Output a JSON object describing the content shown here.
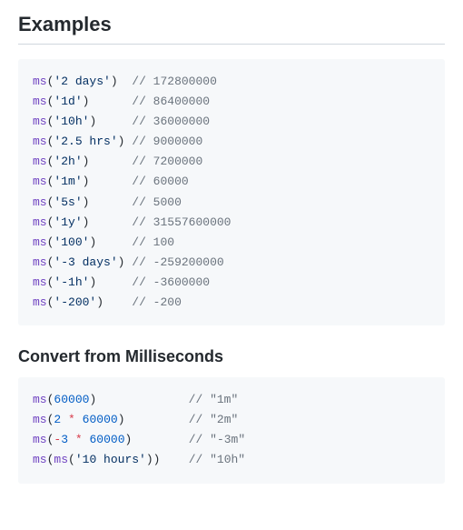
{
  "heading_examples": "Examples",
  "heading_convert": "Convert from Milliseconds",
  "block1": [
    {
      "call": "ms",
      "arg_type": "str",
      "arg": "'2 days'",
      "pad": "  ",
      "comment": "// 172800000"
    },
    {
      "call": "ms",
      "arg_type": "str",
      "arg": "'1d'",
      "pad": "      ",
      "comment": "// 86400000"
    },
    {
      "call": "ms",
      "arg_type": "str",
      "arg": "'10h'",
      "pad": "     ",
      "comment": "// 36000000"
    },
    {
      "call": "ms",
      "arg_type": "str",
      "arg": "'2.5 hrs'",
      "pad": " ",
      "comment": "// 9000000"
    },
    {
      "call": "ms",
      "arg_type": "str",
      "arg": "'2h'",
      "pad": "      ",
      "comment": "// 7200000"
    },
    {
      "call": "ms",
      "arg_type": "str",
      "arg": "'1m'",
      "pad": "      ",
      "comment": "// 60000"
    },
    {
      "call": "ms",
      "arg_type": "str",
      "arg": "'5s'",
      "pad": "      ",
      "comment": "// 5000"
    },
    {
      "call": "ms",
      "arg_type": "str",
      "arg": "'1y'",
      "pad": "      ",
      "comment": "// 31557600000"
    },
    {
      "call": "ms",
      "arg_type": "str",
      "arg": "'100'",
      "pad": "     ",
      "comment": "// 100"
    },
    {
      "call": "ms",
      "arg_type": "str",
      "arg": "'-3 days'",
      "pad": " ",
      "comment": "// -259200000"
    },
    {
      "call": "ms",
      "arg_type": "str",
      "arg": "'-1h'",
      "pad": "     ",
      "comment": "// -3600000"
    },
    {
      "call": "ms",
      "arg_type": "str",
      "arg": "'-200'",
      "pad": "    ",
      "comment": "// -200"
    }
  ],
  "block2": [
    {
      "tokens": [
        {
          "t": "fn",
          "v": "ms"
        },
        {
          "t": "plain",
          "v": "("
        },
        {
          "t": "num",
          "v": "60000"
        },
        {
          "t": "plain",
          "v": ")"
        }
      ],
      "pad": "             ",
      "comment": "// \"1m\""
    },
    {
      "tokens": [
        {
          "t": "fn",
          "v": "ms"
        },
        {
          "t": "plain",
          "v": "("
        },
        {
          "t": "num",
          "v": "2"
        },
        {
          "t": "plain",
          "v": " "
        },
        {
          "t": "op",
          "v": "*"
        },
        {
          "t": "plain",
          "v": " "
        },
        {
          "t": "num",
          "v": "60000"
        },
        {
          "t": "plain",
          "v": ")"
        }
      ],
      "pad": "         ",
      "comment": "// \"2m\""
    },
    {
      "tokens": [
        {
          "t": "fn",
          "v": "ms"
        },
        {
          "t": "plain",
          "v": "("
        },
        {
          "t": "op",
          "v": "-"
        },
        {
          "t": "num",
          "v": "3"
        },
        {
          "t": "plain",
          "v": " "
        },
        {
          "t": "op",
          "v": "*"
        },
        {
          "t": "plain",
          "v": " "
        },
        {
          "t": "num",
          "v": "60000"
        },
        {
          "t": "plain",
          "v": ")"
        }
      ],
      "pad": "        ",
      "comment": "// \"-3m\""
    },
    {
      "tokens": [
        {
          "t": "fn",
          "v": "ms"
        },
        {
          "t": "plain",
          "v": "("
        },
        {
          "t": "fn",
          "v": "ms"
        },
        {
          "t": "plain",
          "v": "("
        },
        {
          "t": "str",
          "v": "'10 hours'"
        },
        {
          "t": "plain",
          "v": "))"
        }
      ],
      "pad": "    ",
      "comment": "// \"10h\""
    }
  ]
}
